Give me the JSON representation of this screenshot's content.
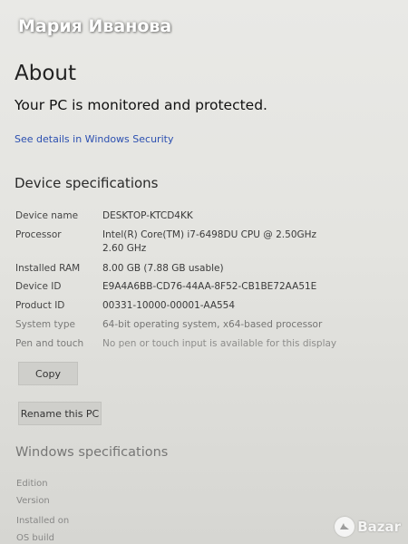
{
  "overlay": {
    "user_name": "Мария Иванова"
  },
  "page": {
    "title": "About",
    "protection_status": "Your PC is monitored and protected.",
    "security_link": "See details in Windows Security"
  },
  "device_specs": {
    "title": "Device specifications",
    "rows": [
      {
        "label": "Device name",
        "value": "DESKTOP-KTCD4KK"
      },
      {
        "label": "Processor",
        "value": "Intel(R) Core(TM) i7-6498DU CPU @ 2.50GHz",
        "value2": "2.60 GHz"
      },
      {
        "label": "Installed RAM",
        "value": "8.00 GB (7.88 GB usable)"
      },
      {
        "label": "Device ID",
        "value": "E9A4A6BB-CD76-44AA-8F52-CB1BE72AA51E"
      },
      {
        "label": "Product ID",
        "value": "00331-10000-00001-AA554"
      },
      {
        "label": "System type",
        "value": "64-bit operating system, x64-based processor"
      },
      {
        "label": "Pen and touch",
        "value": "No pen or touch input is available for this display"
      }
    ],
    "copy_button": "Copy",
    "rename_button": "Rename this PC"
  },
  "windows_specs": {
    "title": "Windows specifications",
    "labels": [
      "Edition",
      "Version",
      "Installed on",
      "OS build"
    ]
  },
  "watermark": {
    "text": "Bazar"
  },
  "colors": {
    "link": "#2b4fb0",
    "background": "#e6e6e2"
  }
}
